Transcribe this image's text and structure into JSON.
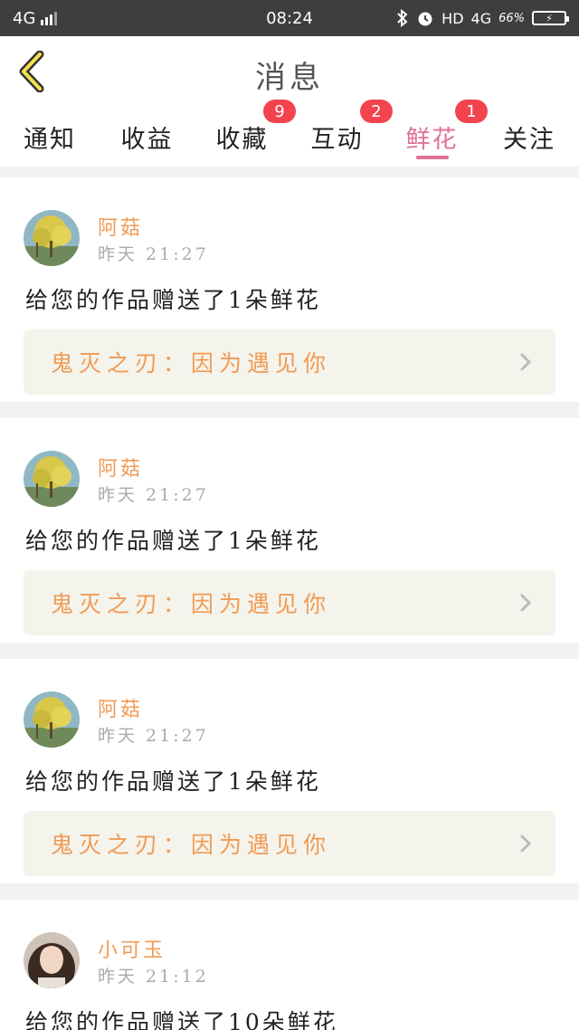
{
  "status_bar": {
    "network": "4G",
    "time": "08:24",
    "hd": "HD",
    "network_right": "4G",
    "signal_text": "66%"
  },
  "header": {
    "title": "消息"
  },
  "tabs": [
    {
      "label": "通知",
      "badge": ""
    },
    {
      "label": "收益",
      "badge": ""
    },
    {
      "label": "收藏",
      "badge": "9"
    },
    {
      "label": "互动",
      "badge": "2"
    },
    {
      "label": "鲜花",
      "badge": "1",
      "active": true
    },
    {
      "label": "关注",
      "badge": ""
    }
  ],
  "colors": {
    "accent": "#e0709b",
    "badge": "#f2434f",
    "username": "#f09b55",
    "link_bg": "#f4f4ec"
  },
  "messages": [
    {
      "user": "阿菇",
      "time": "昨天 21:27",
      "text": "给您的作品赠送了1朵鲜花",
      "work": "鬼灭之刃：因为遇见你",
      "avatar": "tree-avatar"
    },
    {
      "user": "阿菇",
      "time": "昨天 21:27",
      "text": "给您的作品赠送了1朵鲜花",
      "work": "鬼灭之刃：因为遇见你",
      "avatar": "tree-avatar"
    },
    {
      "user": "阿菇",
      "time": "昨天 21:27",
      "text": "给您的作品赠送了1朵鲜花",
      "work": "鬼灭之刃：因为遇见你",
      "avatar": "tree-avatar"
    },
    {
      "user": "小可玉",
      "time": "昨天 21:12",
      "text": "给您的作品赠送了10朵鲜花",
      "work": "",
      "avatar": "girl-avatar"
    }
  ]
}
